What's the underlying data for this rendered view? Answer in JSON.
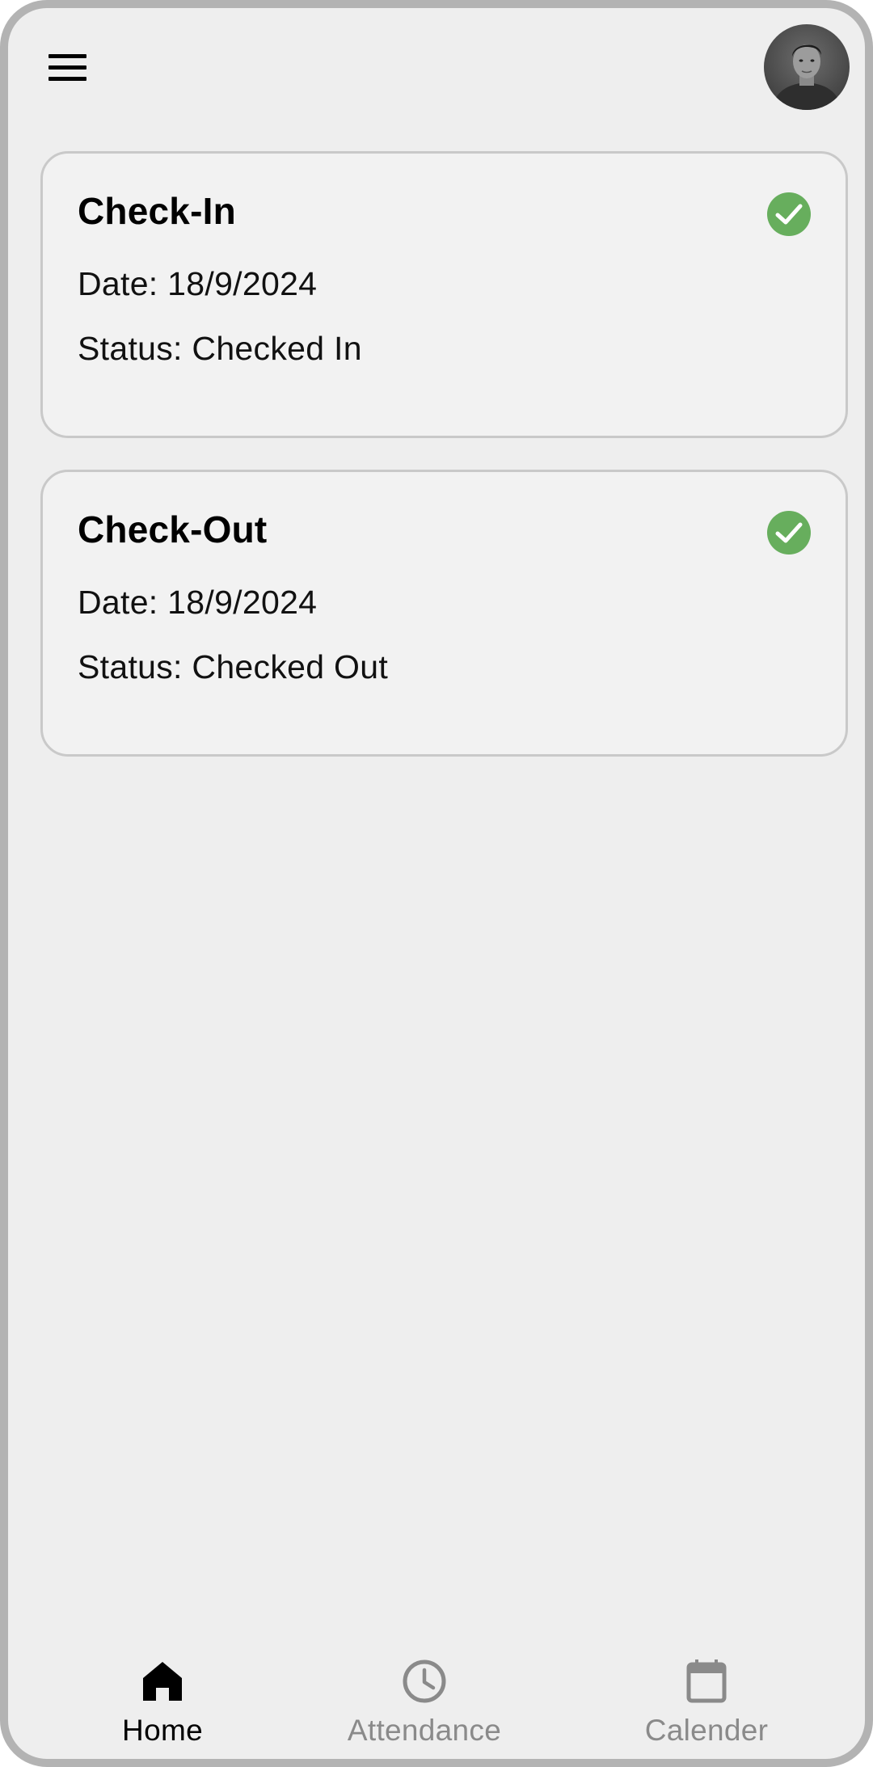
{
  "header": {
    "menu_icon": "hamburger-menu-icon",
    "avatar": "user-profile-photo"
  },
  "cards": [
    {
      "title": "Check-In",
      "date": "Date: 18/9/2024",
      "status": "Status: Checked In",
      "icon": "check-circle-icon"
    },
    {
      "title": "Check-Out",
      "date": "Date: 18/9/2024",
      "status": "Status: Checked Out",
      "icon": "check-circle-icon"
    }
  ],
  "bottom_nav": {
    "items": [
      {
        "label": "Home",
        "icon": "home-icon",
        "active": true
      },
      {
        "label": "Attendance",
        "icon": "clock-icon",
        "active": false
      },
      {
        "label": "Calender",
        "icon": "calendar-icon",
        "active": false
      }
    ]
  },
  "colors": {
    "background": "#eeeeee",
    "card_background": "#f2f2f2",
    "card_border": "#c9c9c9",
    "success_green": "#67ae5d",
    "nav_active": "#000000",
    "nav_inactive": "#8a8a8a",
    "frame": "#b3b3b3"
  }
}
